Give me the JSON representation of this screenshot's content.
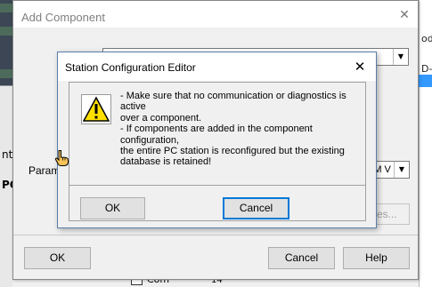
{
  "background": {
    "left_labels": [
      "nt",
      "PC"
    ],
    "right_labels": [
      "ode",
      "D-"
    ],
    "bottom_checkbox_label": "Com",
    "bottom_number": "14"
  },
  "add_component": {
    "title": "Add Component",
    "parameter_label": "Parame",
    "interface_value": "PM V",
    "properties_button": "es...",
    "ok_button": "OK",
    "cancel_button": "Cancel",
    "help_button": "Help"
  },
  "station_editor": {
    "title": "Station Configuration Editor",
    "message_lines": [
      "- Make sure that no communication or diagnostics is active",
      "over a component.",
      "- If components are added in the component configuration,",
      "the entire PC station is reconfigured but the existing",
      "database is retained!"
    ],
    "ok_button": "OK",
    "cancel_button": "Cancel",
    "icon": "warning-icon"
  }
}
